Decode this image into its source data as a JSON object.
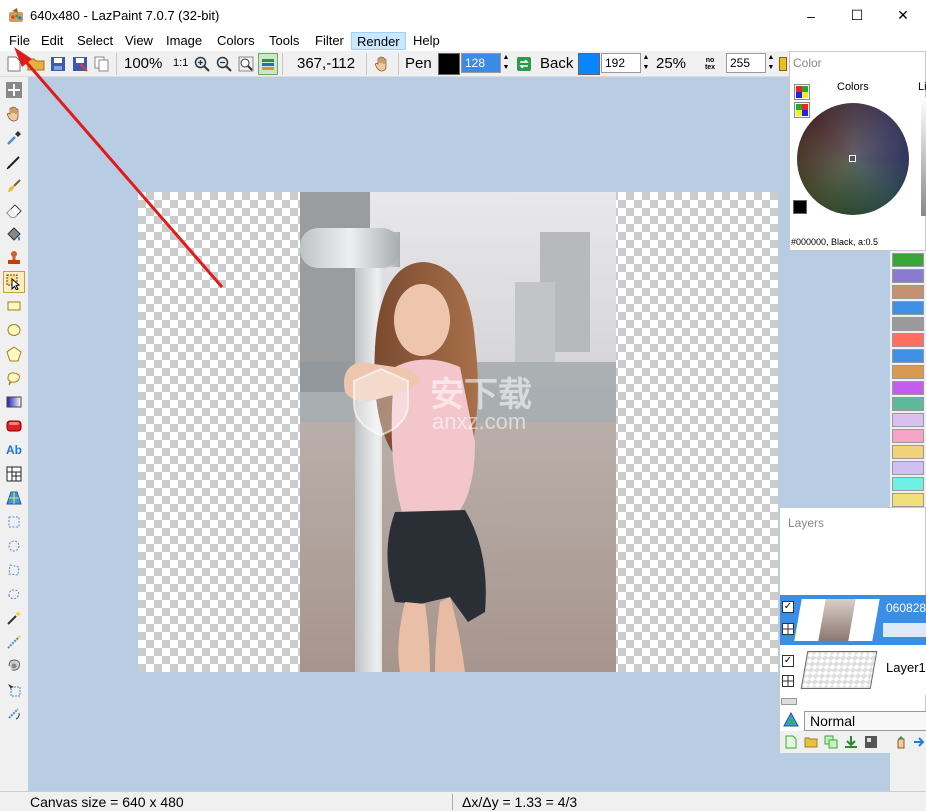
{
  "window": {
    "title": "640x480 - LazPaint 7.0.7 (32-bit)",
    "minimize": "–",
    "maximize": "☐",
    "close": "✕"
  },
  "menu": {
    "items": [
      "File",
      "Edit",
      "Select",
      "View",
      "Image",
      "Colors",
      "Tools",
      "Filter",
      "Render",
      "Help"
    ]
  },
  "toolbar": {
    "zoom": "100%",
    "ratio": "1:1",
    "coords": "367,-112",
    "pen_label": "Pen",
    "pen_color": "#000000",
    "pen_alpha": "128",
    "back_label": "Back",
    "back_color": "#0a84ff",
    "back_alpha": "192",
    "opacity": "25%",
    "notex": "no tex",
    "tex_alpha": "255"
  },
  "color_panel": {
    "title": "Color",
    "colors_label": "Colors",
    "lightness_label": "Li",
    "color_info": "#000000, Black, a:0.5"
  },
  "palette": {
    "colors": [
      "#3aa63a",
      "#8a7ad0",
      "#c49270",
      "#3f90e6",
      "#9a9a9a",
      "#ff6f5f",
      "#3f90e6",
      "#d79a50",
      "#c45cf0",
      "#5fb89a",
      "#d9c0f0",
      "#f5a3c7",
      "#efd27a",
      "#cfc0f0",
      "#6ef0e6",
      "#efe07a",
      "#8ed0f0"
    ]
  },
  "layers": {
    "title": "Layers",
    "layer1_name": "060828",
    "layer2_name": "Layer1",
    "blend_mode": "Normal"
  },
  "status": {
    "canvas_size": "Canvas size = 640 x 480",
    "ratio": "Δx/Δy = 1.33 = 4/3"
  },
  "watermark": {
    "cn": "安下载",
    "en": "anxz.com"
  }
}
